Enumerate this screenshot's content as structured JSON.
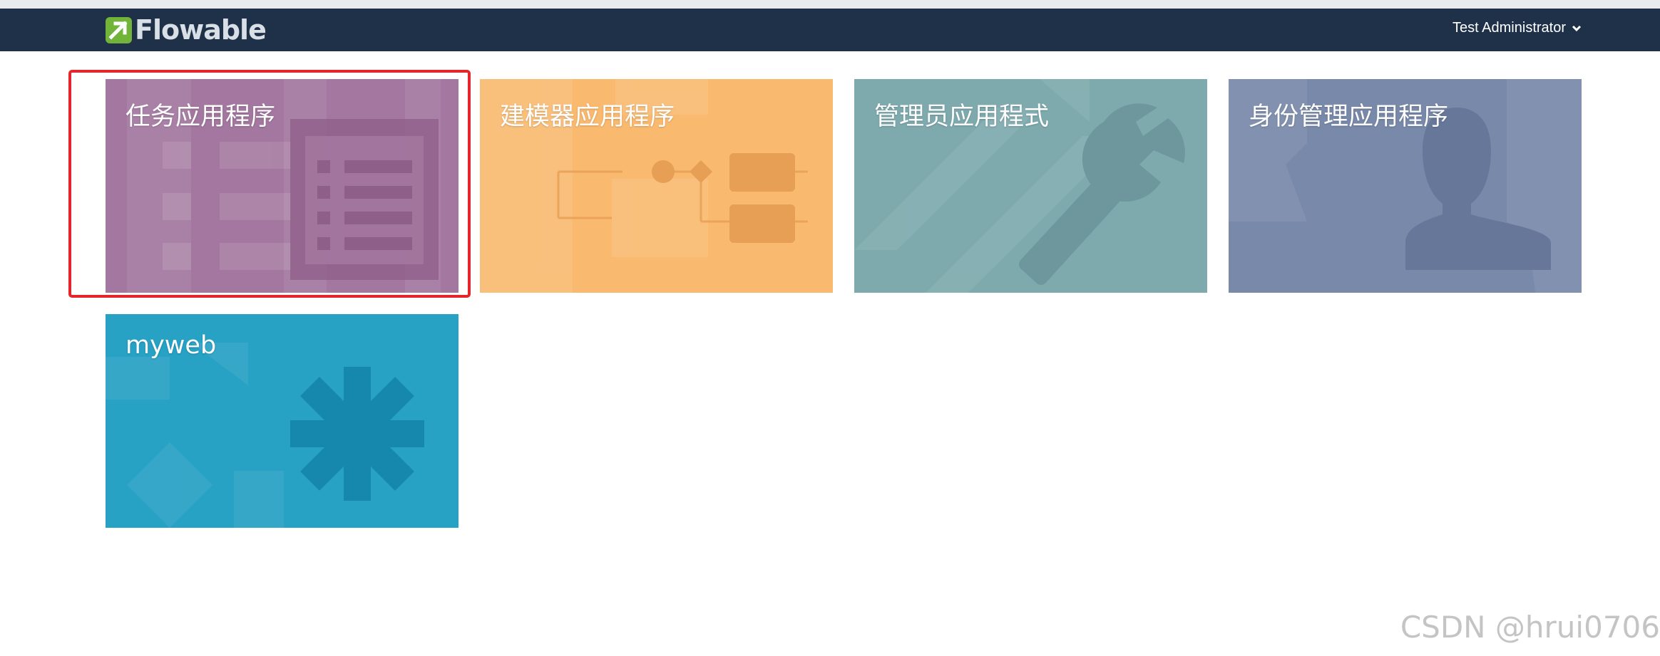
{
  "header": {
    "logo_text": "Flowable",
    "user_name": "Test Administrator",
    "brand_color": "#72b33a",
    "bar_color": "#1f3148"
  },
  "apps": [
    {
      "label": "任务应用程序",
      "icon": "task-list-icon",
      "color": "#a3779f",
      "selected": true
    },
    {
      "label": "建模器应用程序",
      "icon": "process-diagram-icon",
      "color": "#f9b96e",
      "selected": false
    },
    {
      "label": "管理员应用程式",
      "icon": "wrench-icon",
      "color": "#7eaaae",
      "selected": false
    },
    {
      "label": "身份管理应用程序",
      "icon": "user-silhouette-icon",
      "color": "#7989a9",
      "selected": false
    },
    {
      "label": "myweb",
      "icon": "asterisk-icon",
      "color": "#27a1c4",
      "selected": false
    }
  ],
  "highlight_color": "#e4252b",
  "watermark": "CSDN @hrui0706"
}
